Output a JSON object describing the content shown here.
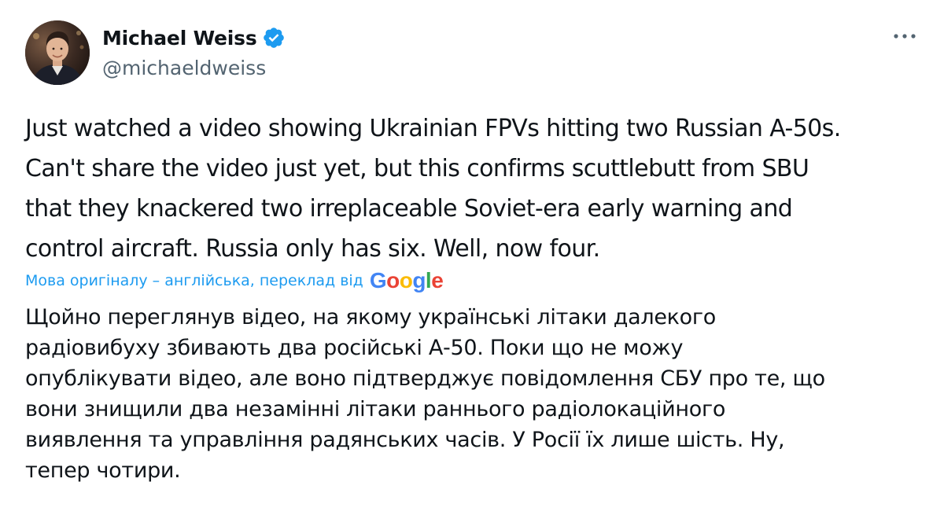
{
  "author": {
    "display_name": "Michael Weiss",
    "handle": "@michaeldweiss",
    "verified_icon": "verified-badge-icon",
    "verified_color": "#1d9bf0"
  },
  "menu": {
    "icon": "more-options-icon"
  },
  "tweet": {
    "text": "Just watched a video showing Ukrainian FPVs hitting two Russian A-50s.\nCan't share the video just yet, but this confirms scuttlebutt from SBU\nthat they knackered two irreplaceable Soviet-era early warning and\ncontrol aircraft. Russia only has six. Well, now four."
  },
  "translation": {
    "credit_label": "Мова оригіналу – англійська, переклад від",
    "provider": "Google",
    "provider_colors": [
      "#4285f4",
      "#ea4335",
      "#fbbc05",
      "#4285f4",
      "#34a853",
      "#ea4335"
    ],
    "text": "Щойно переглянув відео, на якому українські літаки далекого\nрадіовибуху збивають два російські А-50. Поки що не можу\nопублікувати відео, але воно підтверджує повідомлення СБУ про те, що\nвони знищили два незамінні літаки раннього радіолокаційного\nвиявлення та управління радянських часів. У Росії їх лише шість. Ну,\nтепер чотири."
  },
  "colors": {
    "link": "#1d9bf0",
    "secondary_text": "#536471",
    "primary_text": "#0f1419"
  }
}
